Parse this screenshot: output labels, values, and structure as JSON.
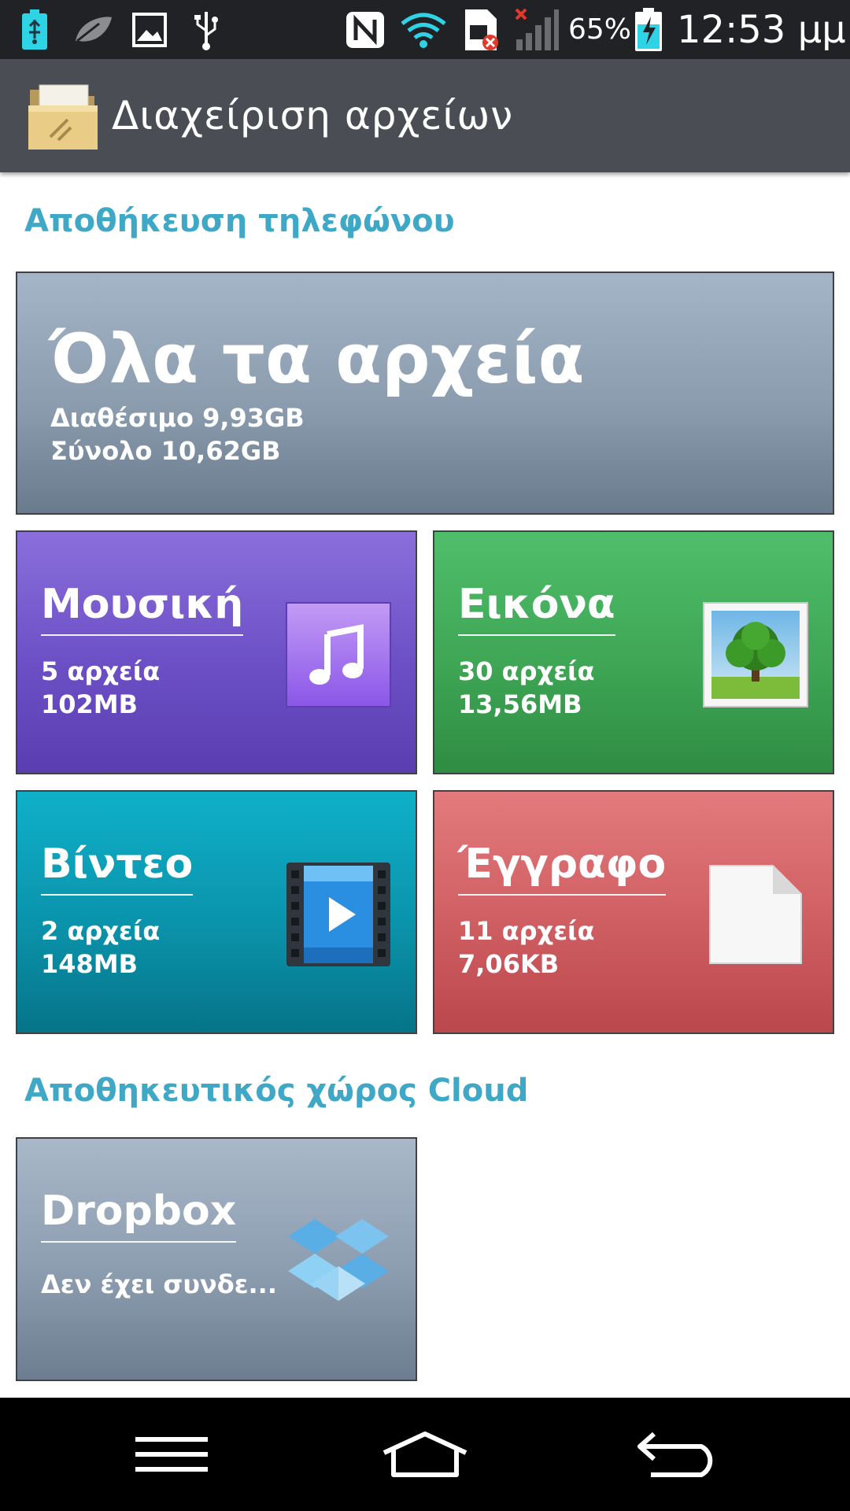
{
  "status_bar": {
    "battery_percent": "65%",
    "clock": "12:53 μμ",
    "icons": [
      "usb-debug-icon",
      "leaf-icon",
      "image-notification-icon",
      "usb-icon",
      "nfc-icon",
      "wifi-icon",
      "sim-error-icon",
      "signal-no-service-icon",
      "battery-charging-icon"
    ]
  },
  "app_bar": {
    "title": "Διαχείριση αρχείων",
    "icon": "folder-icon"
  },
  "phone_storage": {
    "heading": "Αποθήκευση τηλεφώνου",
    "all_files": {
      "title": "Όλα τα αρχεία",
      "available": "Διαθέσιμο 9,93GB",
      "total": "Σύνολο 10,62GB"
    },
    "categories": [
      {
        "title": "Μουσική",
        "count": "5 αρχεία",
        "size": "102MB",
        "icon": "music-note-icon",
        "color": "#6c4fc6"
      },
      {
        "title": "Εικόνα",
        "count": "30 αρχεία",
        "size": "13,56MB",
        "icon": "picture-tree-icon",
        "color": "#3ea655"
      },
      {
        "title": "Βίντεο",
        "count": "2 αρχεία",
        "size": "148MB",
        "icon": "video-film-icon",
        "color": "#0a93ab"
      },
      {
        "title": "Έγγραφο",
        "count": "11 αρχεία",
        "size": "7,06KB",
        "icon": "document-icon",
        "color": "#cf5e62"
      }
    ]
  },
  "cloud_storage": {
    "heading": "Αποθηκευτικός χώρος Cloud",
    "dropbox": {
      "title": "Dropbox",
      "status": "Δεν έχει συνδε...",
      "icon": "dropbox-icon"
    }
  },
  "nav_bar": {
    "icons": [
      "menu-icon",
      "home-icon",
      "back-icon"
    ]
  }
}
